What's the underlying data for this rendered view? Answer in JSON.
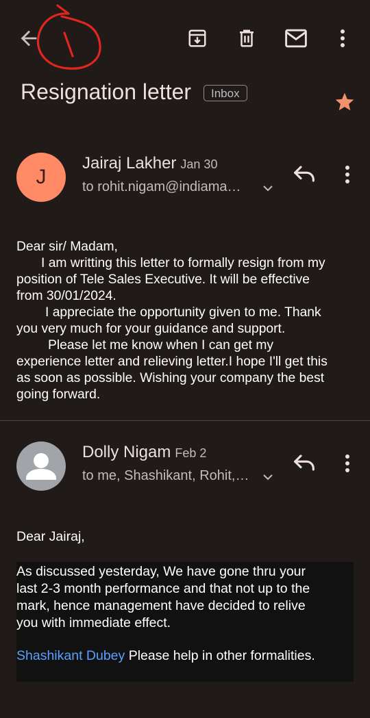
{
  "subject": "Resignation letter",
  "label": "Inbox",
  "messages": [
    {
      "sender": "Jairaj Lakher",
      "avatar_letter": "J",
      "date": "Jan 30",
      "recipients": "to rohit.nigam@indiama…",
      "body": {
        "line1": "Dear sir/ Madam,",
        "line2": "I am writting this letter to formally resign from my",
        "line3": "position of Tele Sales Executive. It will be effective",
        "line4": "from 30/01/2024.",
        "line5": "I appreciate the opportunity given to me. Thank",
        "line6": "you very much for your guidance and support.",
        "line7": "Please let me know when I can get my",
        "line8": "experience letter and relieving letter.I hope I'll get this",
        "line9": "as soon as possible. Wishing your company the best",
        "line10": "going forward."
      }
    },
    {
      "sender": "Dolly Nigam",
      "date": "Feb 2",
      "recipients": "to me, Shashikant, Rohit,…",
      "greeting": "Dear Jairaj,",
      "body": {
        "line1": "As discussed yesterday, We have gone thru your",
        "line2": "last 2-3 month performance and that not up to the",
        "line3": "mark, hence management have decided to relive",
        "line4": "you with immediate effect."
      },
      "mention": "Shashikant Dubey",
      "last_line": " Please help in other formalities."
    }
  ],
  "colors": {
    "background": "#201a19",
    "star": "#f4916a",
    "avatar_j": "#ff8a65",
    "mention": "#5aa0ff",
    "scribble": "#e0261d"
  }
}
